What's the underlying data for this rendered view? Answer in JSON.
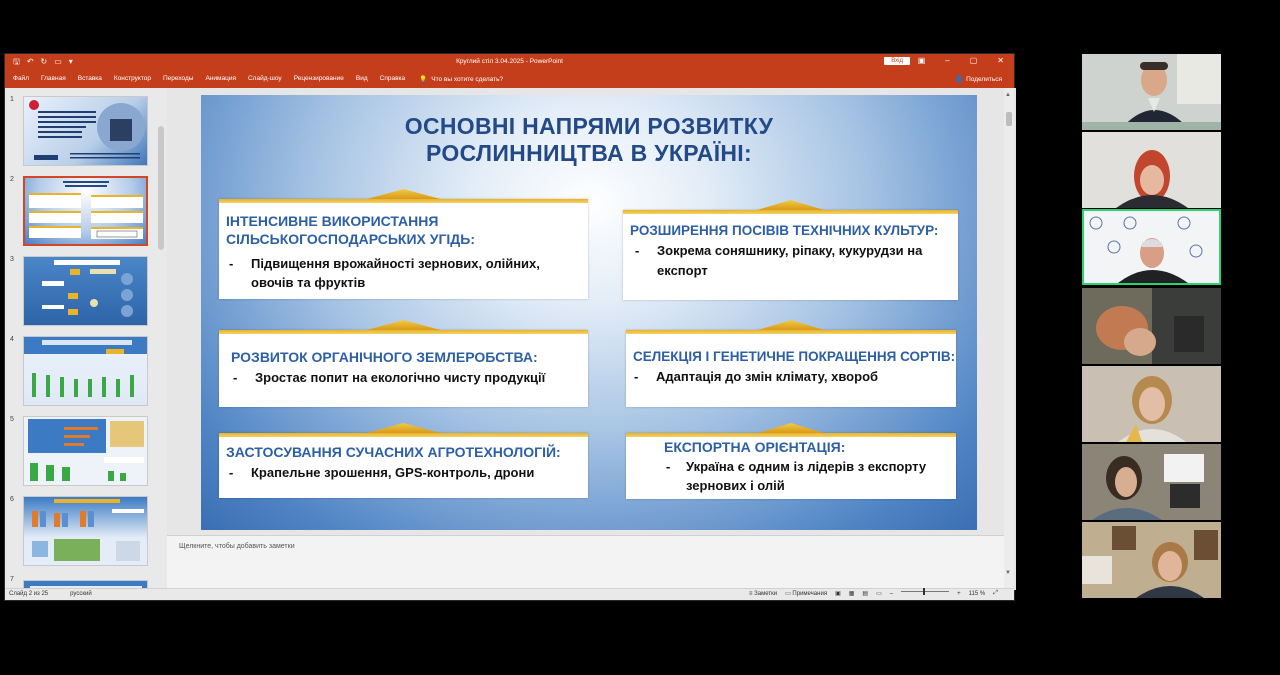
{
  "window": {
    "title": "Круглий стіл 3.04.2025  -  PowerPoint",
    "signin_label": "Вхід",
    "share_label": "Поделиться"
  },
  "menu": {
    "items": [
      "Файл",
      "Главная",
      "Вставка",
      "Конструктор",
      "Переходы",
      "Анимация",
      "Слайд-шоу",
      "Рецензирование",
      "Вид",
      "Справка"
    ],
    "tell_me": "Что вы хотите сделать?"
  },
  "thumbnails": {
    "numbers": [
      "1",
      "2",
      "3",
      "4",
      "5",
      "6",
      "7"
    ],
    "selected": 2
  },
  "slide": {
    "title_line1": "ОСНОВНІ НАПРЯМИ РОЗВИТКУ",
    "title_line2": "РОСЛИННИЦТВА В УКРАЇНІ:",
    "cards": [
      {
        "head": [
          "ІНТЕНСИВНЕ ВИКОРИСТАННЯ",
          "СІЛЬСЬКОГОСПОДАРСЬКИХ УГІДЬ:"
        ],
        "bullets": [
          "Підвищення врожайності зернових, олійних,",
          "овочів та фруктів"
        ]
      },
      {
        "head": [
          "РОЗШИРЕННЯ ПОСІВІВ ТЕХНІЧНИХ КУЛЬТУР:"
        ],
        "bullets": [
          "Зокрема соняшнику, ріпаку, кукурудзи на",
          "експорт"
        ]
      },
      {
        "head": [
          "РОЗВИТОК ОРГАНІЧНОГО ЗЕМЛЕРОБСТВА:"
        ],
        "bullets": [
          "Зростає попит на екологічно чисту продукції"
        ]
      },
      {
        "head": [
          "СЕЛЕКЦІЯ І ГЕНЕТИЧНЕ ПОКРАЩЕННЯ СОРТІВ:"
        ],
        "bullets": [
          "Адаптація до змін клімату, хвороб"
        ]
      },
      {
        "head": [
          "ЗАСТОСУВАННЯ СУЧАСНИХ АГРОТЕХНОЛОГІЙ:"
        ],
        "bullets": [
          "Крапельне зрошення, GPS-контроль, дрони"
        ]
      },
      {
        "head": [
          "ЕКСПОРТНА ОРІЄНТАЦІЯ:"
        ],
        "bullets": [
          "Україна є одним із лідерів з експорту",
          "зернових і олій"
        ]
      }
    ],
    "bullet_dash": "-"
  },
  "notes": {
    "placeholder": "Щелкните, чтобы добавить заметки"
  },
  "status": {
    "slide_counter": "Слайд 2 из 25",
    "language": "русский",
    "notes_label": "Заметки",
    "comments_label": "Примечания",
    "zoom": "115 %"
  },
  "colors": {
    "ppt_accent": "#c43e1c",
    "slide_title": "#234a87",
    "card_head": "#2c5fa4",
    "gold": "#e9b32a",
    "active_speaker": "#2fd271"
  }
}
